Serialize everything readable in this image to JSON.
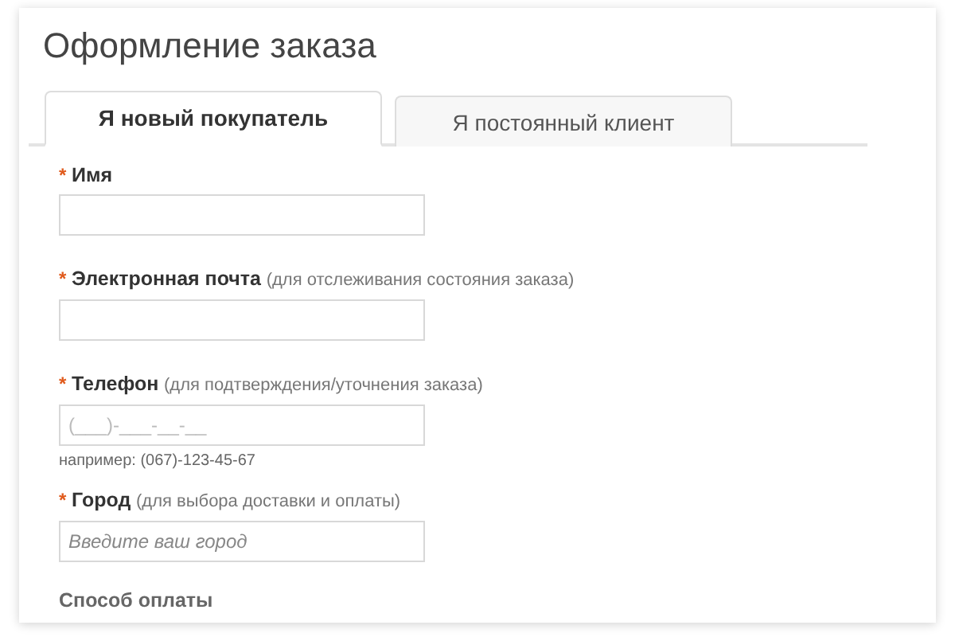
{
  "title": "Оформление заказа",
  "tabs": [
    {
      "label": "Я новый покупатель",
      "selected": true
    },
    {
      "label": "Я постоянный клиент",
      "selected": false
    }
  ],
  "fields": [
    {
      "kind": "text",
      "marker": "*",
      "label": "Имя"
    },
    {
      "kind": "text",
      "marker": "*",
      "label": "Электронная почта",
      "note": "(для отслеживания состояния заказа)"
    },
    {
      "kind": "masked",
      "marker": "*",
      "label": "Телефон",
      "note": "(для подтверждения/уточнения заказа)",
      "placeholder": "(___)-___-__-__",
      "example": "например: (067)-123-45-67"
    },
    {
      "kind": "lookup",
      "marker": "*",
      "label": "Город",
      "note": "(для выбора доставки и оплаты)",
      "placeholder": "Введите ваш город"
    }
  ],
  "section": "Способ оплаты"
}
